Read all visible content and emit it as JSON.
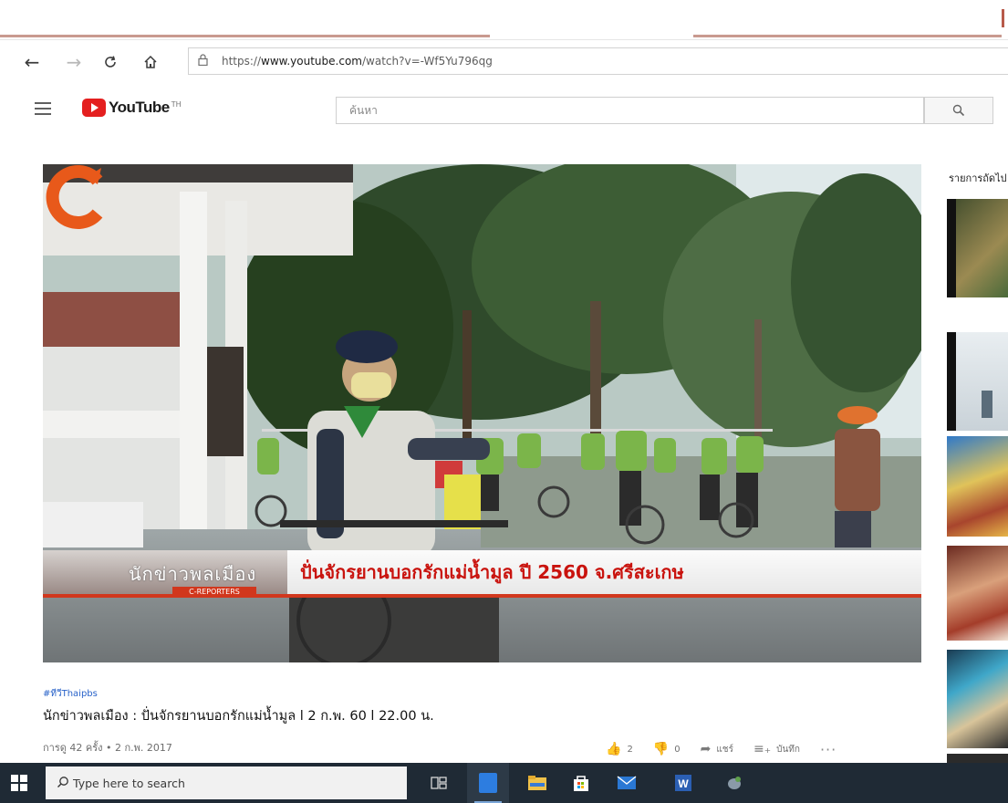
{
  "browser": {
    "url_prefix": "https://",
    "url_domain": "www.youtube.com",
    "url_path": "/watch?v=-Wf5Yu796qg"
  },
  "youtube": {
    "brand": "YouTube",
    "tm": "TH",
    "search_placeholder": "ค้นหา"
  },
  "video": {
    "overlay_name": "นักข่าวพลเมือง",
    "overlay_sub": "C-REPORTERS",
    "overlay_headline": "ปั่นจักรยานบอกรักแม่น้ำมูล ปี 2560 จ.ศรีสะเกษ",
    "hashtag": "#ทีวีThaipbs",
    "title": "นักข่าวพลเมือง : ปั่นจักรยานบอกรักแม่น้ำมูล l 2 ก.พ. 60 l 22.00 น.",
    "views": "การดู 42 ครั้ง • 2 ก.พ. 2017",
    "likes": "2",
    "dislikes": "0",
    "share_label": "แชร์",
    "save_label": "บันทึก",
    "more_label": "···"
  },
  "sidebar": {
    "title": "รายการถัดไป"
  },
  "taskbar": {
    "search_placeholder": "Type here to search"
  },
  "colors": {
    "yt_red": "#e41f1f",
    "taskbar_bg": "#1f2a35",
    "headline_red": "#c9130e",
    "lower_third_red": "#d1371d",
    "link_blue": "#2862c9"
  },
  "icons": [
    "back-arrow-icon",
    "forward-arrow-icon",
    "refresh-icon",
    "home-icon",
    "lock-icon",
    "hamburger-menu-icon",
    "youtube-play-icon",
    "search-icon",
    "like-icon",
    "dislike-icon",
    "share-icon",
    "save-playlist-icon",
    "more-icon",
    "windows-start-icon",
    "task-view-icon",
    "edge-icon",
    "file-explorer-icon",
    "store-icon",
    "mail-icon",
    "word-icon",
    "app-icon"
  ]
}
